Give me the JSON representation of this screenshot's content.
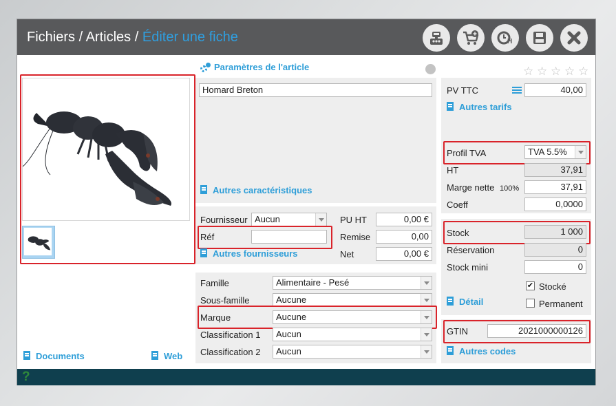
{
  "breadcrumb": {
    "part1": "Fichiers",
    "sep1": "/",
    "part2": "Articles",
    "sep2": "/",
    "current": "Éditer une fiche"
  },
  "colors": {
    "titlebar": "#58595b",
    "accent": "#2f9fe0",
    "footer": "#0f3f4e",
    "highlight": "#d9232a",
    "link": "#2e9ed8"
  },
  "toolbar": {
    "icons": [
      "scale-icon",
      "cart-plus-icon",
      "clock-h-icon",
      "save-icon",
      "close-icon"
    ]
  },
  "left": {
    "documents": "Documents",
    "web": "Web"
  },
  "params": {
    "title": "Paramètres de l'article",
    "name_value": "Homard Breton",
    "autres_caracteristiques": "Autres caractéristiques"
  },
  "supplier": {
    "fournisseur_label": "Fournisseur",
    "fournisseur_value": "Aucun",
    "ref_label": "Réf",
    "ref_value": "",
    "autres_fournisseurs": "Autres fournisseurs",
    "pu_ht_label": "PU HT",
    "pu_ht_value": "0,00 €",
    "remise_label": "Remise",
    "remise_value": "0,00",
    "net_label": "Net",
    "net_value": "0,00 €"
  },
  "classification": {
    "famille_label": "Famille",
    "famille_value": "Alimentaire - Pesé",
    "sousfamille_label": "Sous-famille",
    "sousfamille_value": "Aucune",
    "marque_label": "Marque",
    "marque_value": "Aucune",
    "class1_label": "Classification 1",
    "class1_value": "Aucun",
    "class2_label": "Classification 2",
    "class2_value": "Aucun"
  },
  "pricing": {
    "rating": 0,
    "pv_ttc_label": "PV TTC",
    "pv_ttc_value": "40,00",
    "autres_tarifs": "Autres tarifs",
    "profil_tva_label": "Profil TVA",
    "profil_tva_value": "TVA 5.5%",
    "ht_label": "HT",
    "ht_value": "37,91",
    "marge_label": "Marge nette",
    "marge_pct": "100%",
    "marge_value": "37,91",
    "coeff_label": "Coeff",
    "coeff_value": "0,0000"
  },
  "stock": {
    "stock_label": "Stock",
    "stock_value": "1 000",
    "reservation_label": "Réservation",
    "reservation_value": "0",
    "stock_mini_label": "Stock mini",
    "stock_mini_value": "0",
    "stocke_label": "Stocké",
    "stocke_checked": true,
    "detail": "Détail",
    "permanent_label": "Permanent",
    "permanent_checked": false
  },
  "codes": {
    "gtin_label": "GTIN",
    "gtin_value": "2021000000126",
    "autres_codes": "Autres codes"
  },
  "footer": {
    "help": "?"
  }
}
